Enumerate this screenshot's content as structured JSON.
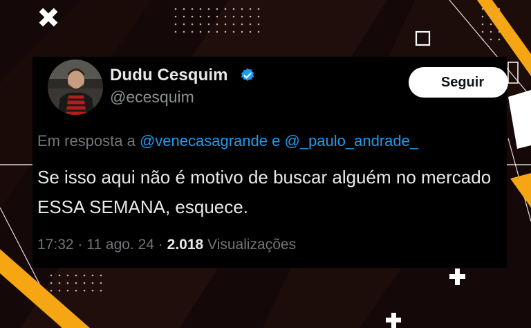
{
  "tweet": {
    "display_name": "Dudu Cesquim",
    "handle": "@ecesquim",
    "follow_label": "Seguir",
    "reply_prefix": "Em resposta a",
    "reply_mention_1": "@venecasagrande",
    "reply_connector": "e",
    "reply_mention_2": "@_paulo_andrade_",
    "text": "Se isso aqui não é motivo de buscar alguém no mercado ESSA SEMANA, esquece.",
    "time": "17:32",
    "separator": "·",
    "date": "11 ago. 24",
    "views_count": "2.018",
    "views_label": "Visualizações"
  },
  "icons": {
    "verified": "verified-badge-icon",
    "avatar": "profile-photo"
  },
  "colors": {
    "background": "#140908",
    "card": "#000000",
    "accent_yellow": "#f5a612",
    "link_blue": "#1d9bf0",
    "text_primary": "#e7e9ea",
    "text_secondary": "#71767b",
    "verified_blue": "#1d9bf0"
  }
}
